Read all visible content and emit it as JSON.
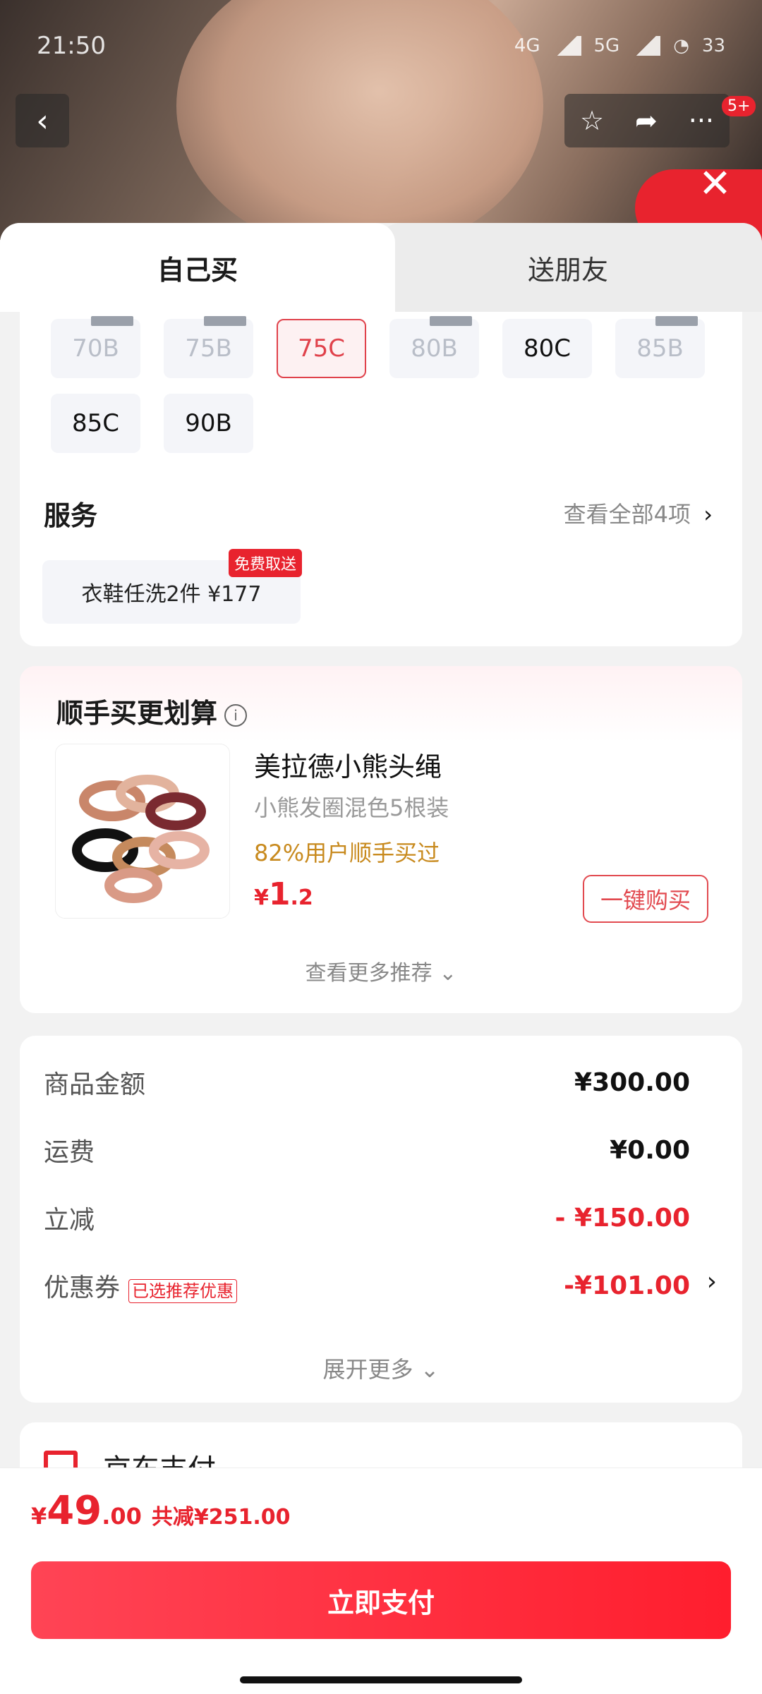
{
  "status_bar": {
    "time": "21:50",
    "battery": "33",
    "net1": "4G",
    "net2": "5G"
  },
  "header": {
    "notify_badge": "5+"
  },
  "tabs": {
    "self": "自己买",
    "friend": "送朋友"
  },
  "sizes": {
    "row1": [
      {
        "label": "70B",
        "state": "disabled"
      },
      {
        "label": "75B",
        "state": "disabled"
      },
      {
        "label": "75C",
        "state": "selected"
      },
      {
        "label": "80B",
        "state": "disabled"
      },
      {
        "label": "80C",
        "state": "normal"
      },
      {
        "label": "85B",
        "state": "disabled"
      }
    ],
    "row2": [
      {
        "label": "85C",
        "state": "normal"
      },
      {
        "label": "90B",
        "state": "normal"
      }
    ]
  },
  "service": {
    "title": "服务",
    "more": "查看全部4项",
    "item": "衣鞋任洗2件  ¥177",
    "badge": "免费取送"
  },
  "addon": {
    "title": "顺手买更划算",
    "product_name": "美拉德小熊头绳",
    "product_sub": "小熊发圈混色5根装",
    "hot": "82%用户顺手买过",
    "price_symbol": "¥",
    "price_int": "1",
    "price_dec": ".2",
    "buy_label": "一键购买",
    "more": "查看更多推荐 ⌄"
  },
  "summary": {
    "goods_label": "商品金额",
    "goods_value": "¥300.00",
    "ship_label": "运费",
    "ship_value": "¥0.00",
    "discount_label": "立减",
    "discount_value": "- ¥150.00",
    "coupon_label": "优惠券",
    "coupon_tag": "已选推荐优惠",
    "coupon_value": "-¥101.00",
    "expand": "展开更多 ⌄"
  },
  "payment": {
    "method": "京东支付"
  },
  "footer": {
    "symbol": "¥",
    "total_int": "49",
    "total_dec": ".00",
    "saved": "共减¥251.00",
    "pay_label": "立即支付"
  },
  "colors": {
    "accent": "#e8232e",
    "gold": "#c88a1e"
  }
}
